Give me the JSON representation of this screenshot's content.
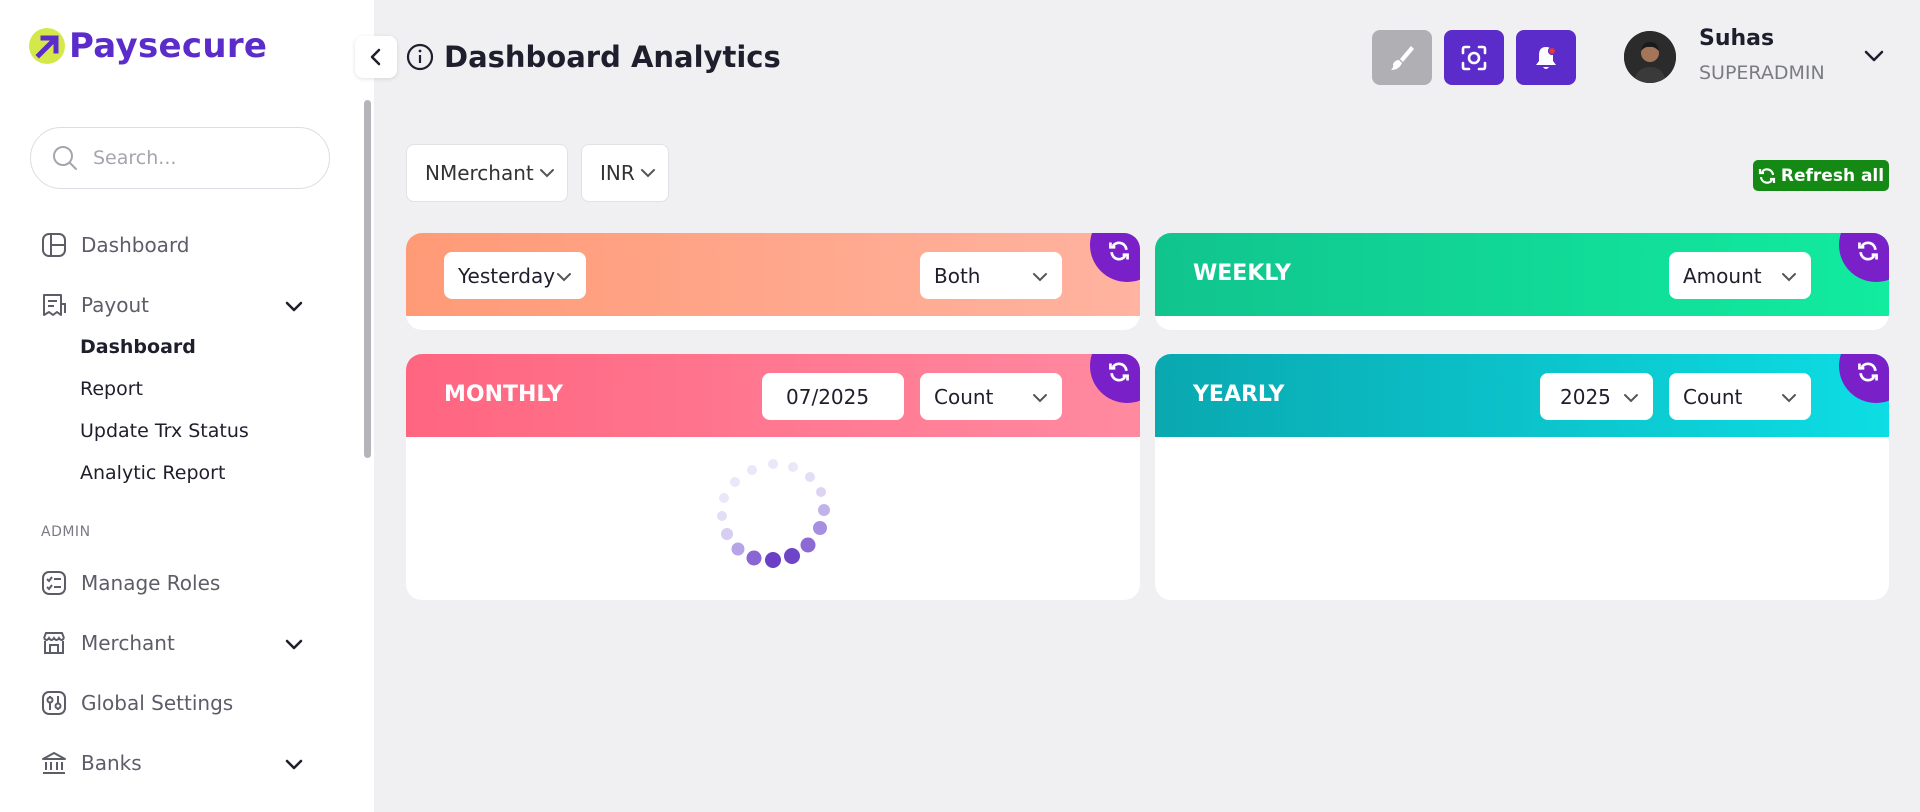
{
  "brand": {
    "name": "Paysecure"
  },
  "search": {
    "placeholder": "Search..."
  },
  "sidebar": {
    "items": [
      {
        "label": "Dashboard"
      },
      {
        "label": "Payout"
      }
    ],
    "payout_sub": [
      "Dashboard",
      "Report",
      "Update Trx Status",
      "Analytic Report"
    ],
    "admin_label": "ADMIN",
    "admin_items": [
      {
        "label": "Manage Roles"
      },
      {
        "label": "Merchant"
      },
      {
        "label": "Global Settings"
      },
      {
        "label": "Banks"
      }
    ]
  },
  "header": {
    "title": "Dashboard Analytics",
    "user": {
      "name": "Suhas",
      "role": "SUPERADMIN"
    }
  },
  "filters": {
    "merchant": "NMerchant",
    "currency": "INR",
    "refresh_all_label": "Refresh all"
  },
  "cards": {
    "daily": {
      "period": "Yesterday",
      "metric": "Both"
    },
    "weekly": {
      "title": "WEEKLY",
      "metric": "Amount"
    },
    "monthly": {
      "title": "MONTHLY",
      "month": "07/2025",
      "metric": "Count"
    },
    "yearly": {
      "title": "YEARLY",
      "year": "2025",
      "metric": "Count"
    }
  },
  "colors": {
    "brand": "#5b2cc9",
    "accent": "#5b2cc9",
    "refresh_all": "#148a14",
    "corner_refresh": "#7a20c8"
  }
}
